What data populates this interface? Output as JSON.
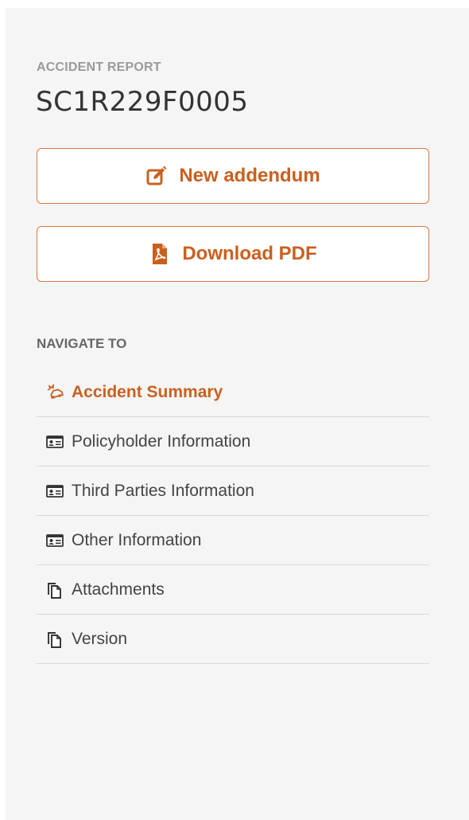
{
  "header": {
    "eyebrow": "ACCIDENT REPORT",
    "report_id": "SC1R229F0005"
  },
  "actions": {
    "new_addendum_label": "New addendum",
    "new_addendum_icon": "edit-icon",
    "download_pdf_label": "Download PDF",
    "download_pdf_icon": "pdf-file-icon"
  },
  "navigation": {
    "heading": "NAVIGATE TO",
    "items": [
      {
        "label": "Accident Summary",
        "icon": "car-crash-icon",
        "active": true
      },
      {
        "label": "Policyholder Information",
        "icon": "id-card-icon",
        "active": false
      },
      {
        "label": "Third Parties Information",
        "icon": "id-card-icon",
        "active": false
      },
      {
        "label": "Other Information",
        "icon": "id-card-icon",
        "active": false
      },
      {
        "label": "Attachments",
        "icon": "copy-icon",
        "active": false
      },
      {
        "label": "Version",
        "icon": "copy-icon",
        "active": false
      }
    ]
  },
  "colors": {
    "accent": "#c9601f",
    "accent_border": "#d9783f",
    "panel_background": "#f5f5f5",
    "text_primary": "#333333",
    "text_muted": "#9a9a9a"
  }
}
